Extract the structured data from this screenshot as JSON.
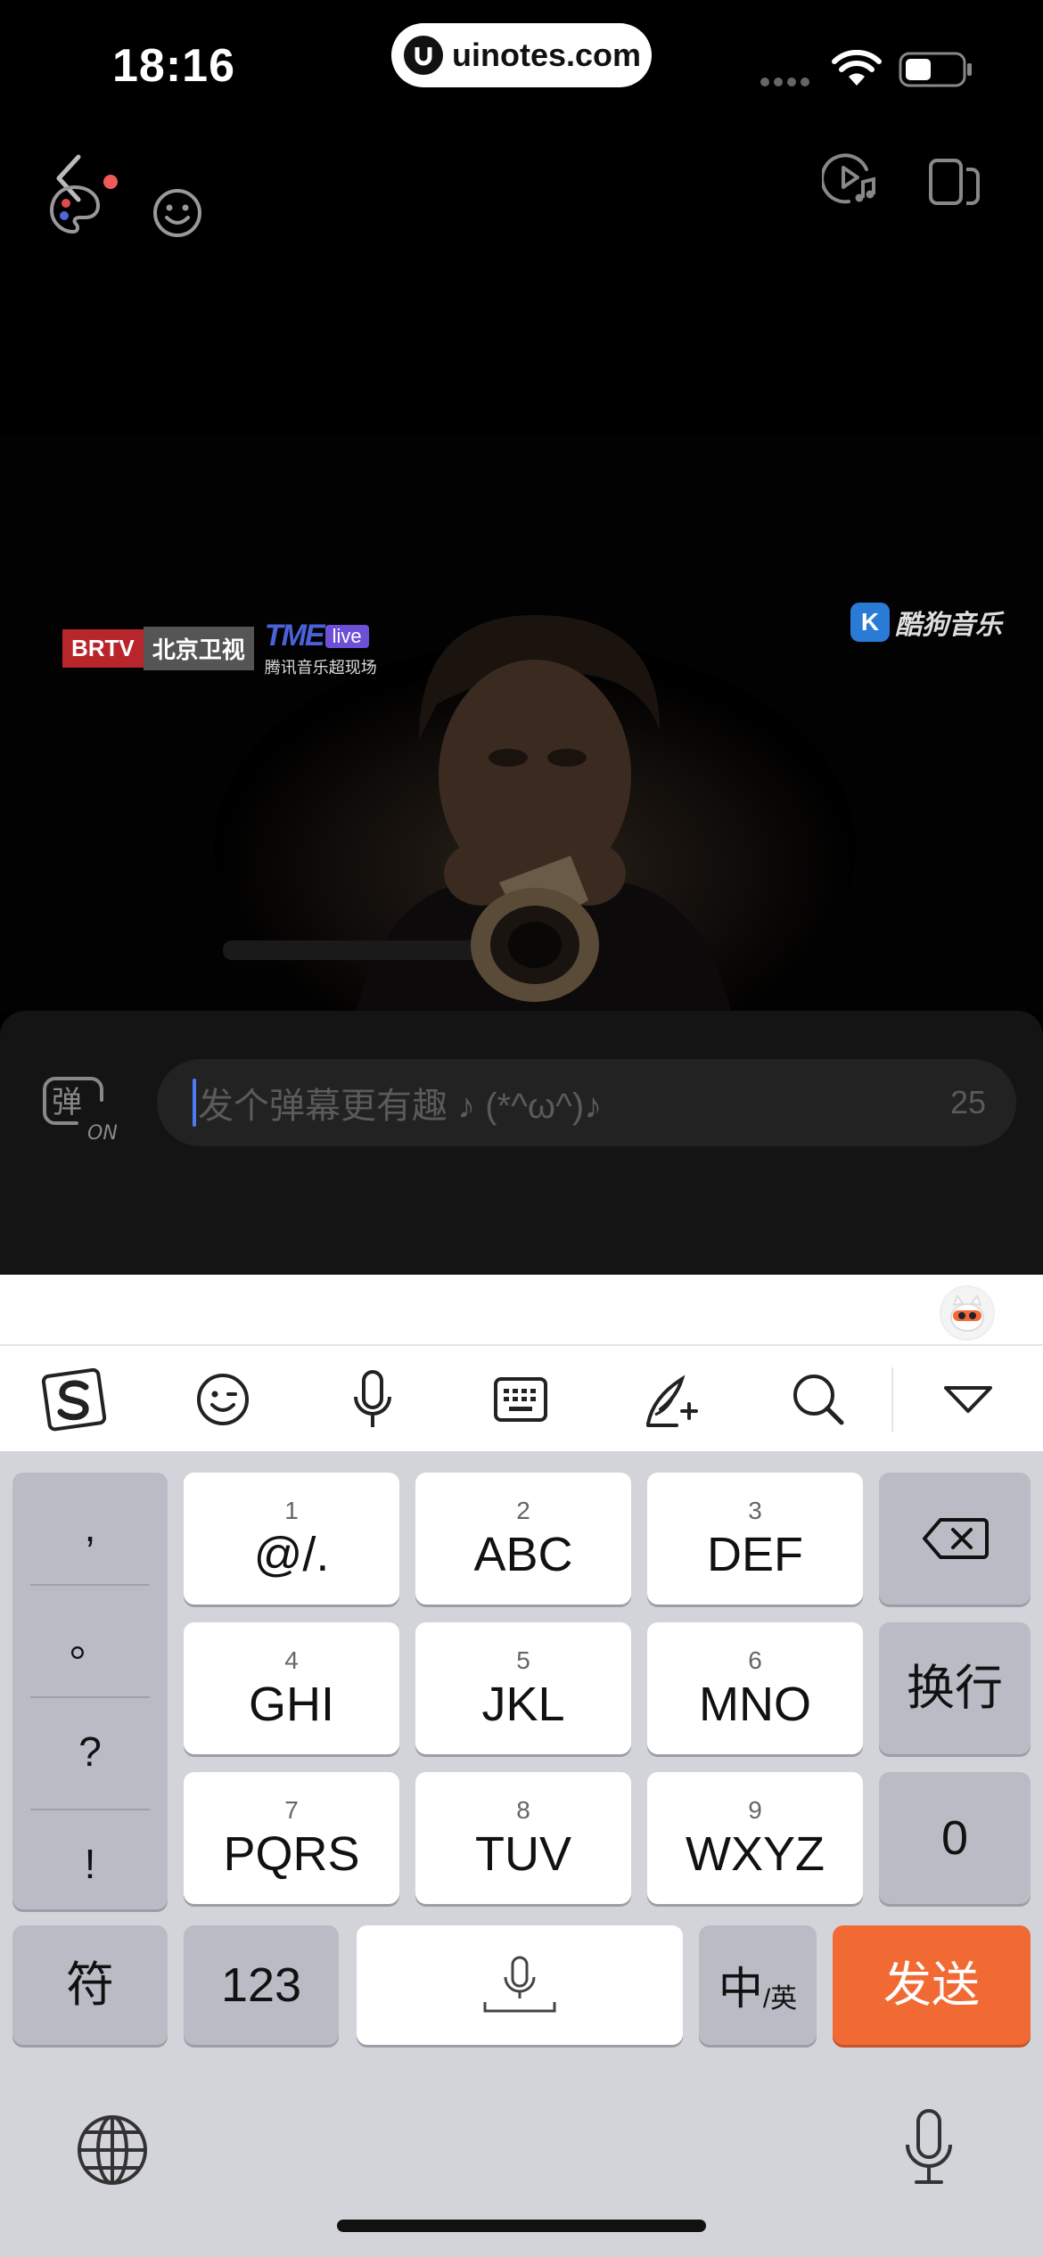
{
  "status_bar": {
    "time": "18:16",
    "url": "uinotes.com"
  },
  "video": {
    "watermark_left": {
      "brtv": "BRTV",
      "channel": "北京卫视",
      "tme": "TME",
      "live": "live",
      "tme_sub": "腾讯音乐超现场"
    },
    "watermark_right": {
      "k": "K",
      "app": "酷狗音乐"
    }
  },
  "danmaku": {
    "toggle_char": "弹",
    "toggle_state": "ON",
    "input_placeholder": "发个弹幕更有趣 ♪ (*^ω^)♪",
    "char_count": "25",
    "palette_dot_color": "#f25a5a"
  },
  "keyboard": {
    "toolbar": [
      "sogou-logo-icon",
      "emoji-icon",
      "voice-icon",
      "keyboard-icon",
      "handwriting-icon",
      "search-icon",
      "collapse-icon"
    ],
    "punctuation": [
      ",",
      "。",
      "?",
      "!"
    ],
    "keys": [
      {
        "num": "1",
        "label": "@/."
      },
      {
        "num": "2",
        "label": "ABC"
      },
      {
        "num": "3",
        "label": "DEF"
      },
      {
        "num": "4",
        "label": "GHI"
      },
      {
        "num": "5",
        "label": "JKL"
      },
      {
        "num": "6",
        "label": "MNO"
      },
      {
        "num": "7",
        "label": "PQRS"
      },
      {
        "num": "8",
        "label": "TUV"
      },
      {
        "num": "9",
        "label": "WXYZ"
      }
    ],
    "newline_key": "换行",
    "zero_key": "0",
    "symbol_key": "符",
    "number_key": "123",
    "lang_key_main": "中",
    "lang_key_sub": "/英",
    "send_key": "发送",
    "accent_color": "#f26a33"
  }
}
